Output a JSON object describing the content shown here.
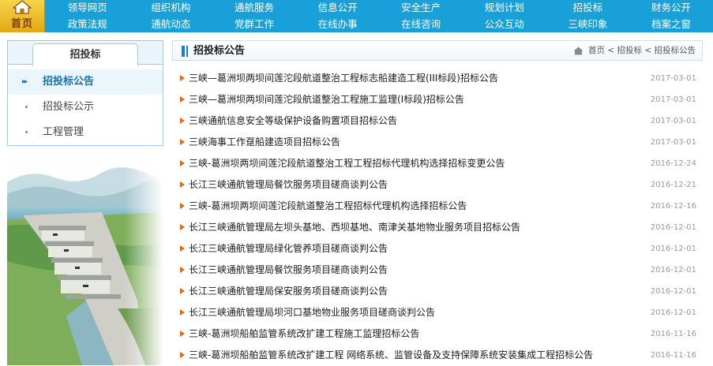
{
  "home": {
    "label": "首页"
  },
  "nav": {
    "row1": [
      "领导网页",
      "组织机构",
      "通航服务",
      "信息公开",
      "安全生产",
      "规划计划",
      "招投标",
      "财务公开"
    ],
    "row2": [
      "政策法规",
      "通航动态",
      "党群工作",
      "在线办事",
      "在线咨询",
      "公众互动",
      "三峡印象",
      "档案之窗"
    ]
  },
  "sidebar": {
    "title": "招投标",
    "items": [
      {
        "label": "招投标公告",
        "active": true
      },
      {
        "label": "招投标公示",
        "active": false
      },
      {
        "label": "工程管理",
        "active": false
      }
    ]
  },
  "content": {
    "title": "招投标公告",
    "breadcrumb": "首页 < 招投标 < 招投标公告"
  },
  "news": [
    {
      "title": "三峡—葛洲坝两坝间莲沱段航道整治工程标志船建造工程(III标段)招标公告",
      "date": "2017-03-01"
    },
    {
      "title": "三峡—葛洲坝两坝间莲沱段航道整治工程施工监理(Ⅰ标段)招标公告",
      "date": "2017-03-01"
    },
    {
      "title": "三峡通航信息安全等级保护设备购置项目招标公告",
      "date": "2017-03-01"
    },
    {
      "title": "三峡海事工作趸船建造项目招标公告",
      "date": "2017-03-01"
    },
    {
      "title": "三峡-葛洲坝两坝间莲沱段航道整治工程工程招标代理机构选择招标变更公告",
      "date": "2016-12-24"
    },
    {
      "title": "长江三峡通航管理局餐饮服务项目磋商谈判公告",
      "date": "2016-12-21"
    },
    {
      "title": "三峡-葛洲坝两坝间莲沱段航道整治工程招标代理机构选择招标公告",
      "date": "2016-12-16"
    },
    {
      "title": "长江三峡通航管理局左坝头基地、西坝基地、南津关基地物业服务项目招标公告",
      "date": "2016-12-01"
    },
    {
      "title": "长江三峡通航管理局绿化管养项目磋商谈判公告",
      "date": "2016-12-01"
    },
    {
      "title": "长江三峡通航管理局餐饮服务项目磋商谈判公告",
      "date": "2016-12-01"
    },
    {
      "title": "长江三峡通航管理局保安服务项目磋商谈判公告",
      "date": "2016-12-01"
    },
    {
      "title": "长江三峡通航管理局坝河口基地物业服务项目磋商谈判公告",
      "date": "2016-12-01"
    },
    {
      "title": "三峡-葛洲坝船舶监管系统改扩建工程施工监理招标公告",
      "date": "2016-11-16"
    },
    {
      "title": "三峡-葛洲坝船舶监管系统改扩建工程 网络系统、监管设备及支持保障系统安装集成工程招标公告",
      "date": "2016-11-16"
    }
  ]
}
